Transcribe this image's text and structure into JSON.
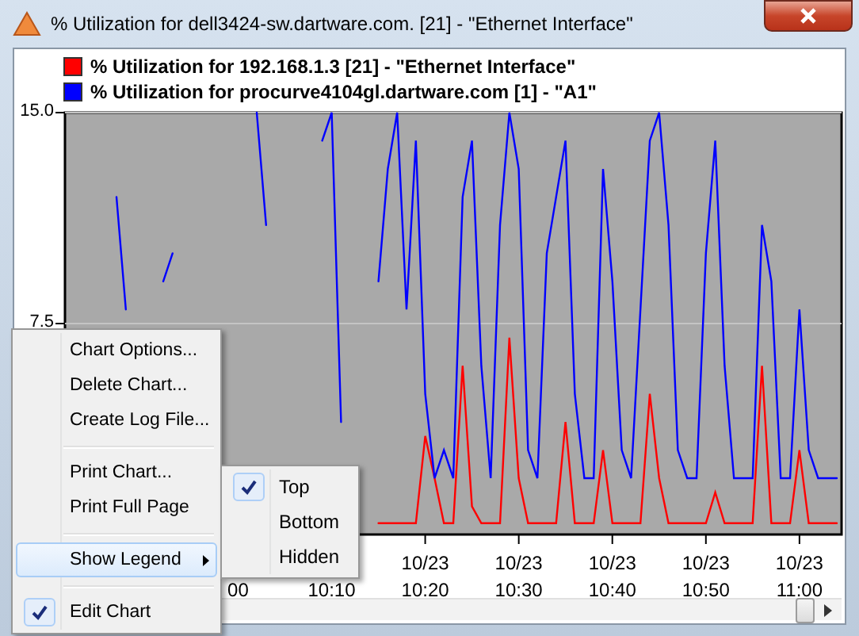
{
  "window": {
    "title": "% Utilization for dell3424-sw.dartware.com. [21] - \"Ethernet Interface\""
  },
  "chart": {
    "chart_data": {
      "type": "line",
      "ylim": [
        0,
        15
      ],
      "yticks": [
        {
          "value": 7.5,
          "label": "7.5"
        },
        {
          "value": 15,
          "label": "15.0"
        }
      ],
      "categories": [
        null,
        null,
        null,
        null,
        null,
        null,
        null,
        null,
        null,
        null,
        null,
        null,
        null,
        null,
        null,
        null,
        null,
        null,
        "00",
        null,
        null,
        null,
        null,
        null,
        null,
        null,
        null,
        null,
        "10:10",
        null,
        null,
        null,
        null,
        null,
        null,
        null,
        null,
        null,
        "10/23 10:20",
        null,
        null,
        null,
        null,
        null,
        null,
        null,
        null,
        null,
        "10/23 10:30",
        null,
        null,
        null,
        null,
        null,
        null,
        null,
        null,
        null,
        "10/23 10:40",
        null,
        null,
        null,
        null,
        null,
        null,
        null,
        null,
        null,
        "10/23 10:50",
        null,
        null,
        null,
        null,
        null,
        null,
        null,
        null,
        null,
        "10/23 11:00",
        null,
        null,
        null,
        null
      ],
      "series": [
        {
          "name": "% Utilization for 192.168.1.3 [21] - \"Ethernet Interface\"",
          "color": "#ff0000",
          "values": [
            null,
            null,
            null,
            null,
            null,
            null,
            null,
            null,
            null,
            null,
            null,
            null,
            null,
            null,
            null,
            null,
            null,
            null,
            null,
            null,
            null,
            null,
            null,
            null,
            null,
            null,
            null,
            null,
            null,
            null,
            null,
            null,
            null,
            0.4,
            0.4,
            0.4,
            0.4,
            0.4,
            3.5,
            2,
            0.4,
            0.4,
            6,
            1,
            0.4,
            0.4,
            0.4,
            7,
            2,
            0.4,
            0.4,
            0.4,
            0.4,
            4,
            0.4,
            0.4,
            0.4,
            3,
            0.4,
            0.4,
            0.4,
            0.4,
            5,
            2,
            0.4,
            0.4,
            0.4,
            0.4,
            0.4,
            1.5,
            0.4,
            0.4,
            0.4,
            0.4,
            6,
            0.4,
            0.4,
            0.4,
            3,
            0.4,
            0.4,
            0.4,
            0.4
          ]
        },
        {
          "name": "% Utilization for procurve4104gl.dartware.com [1] - \"A1\"",
          "color": "#0000ff",
          "values": [
            null,
            null,
            null,
            null,
            null,
            12,
            8,
            null,
            null,
            null,
            9,
            10,
            null,
            null,
            null,
            null,
            null,
            null,
            null,
            null,
            15,
            11,
            null,
            null,
            null,
            null,
            null,
            14,
            15,
            4,
            null,
            null,
            null,
            9,
            13,
            15,
            8,
            14,
            5,
            2,
            3,
            2,
            12,
            14,
            6,
            2,
            11,
            15,
            13,
            3,
            2,
            10,
            12,
            14,
            5,
            2,
            2,
            13,
            9,
            3,
            2,
            8,
            14,
            15,
            11,
            3,
            2,
            2,
            10,
            14,
            6,
            2,
            2,
            2,
            11,
            9,
            2,
            2,
            8,
            3,
            2,
            2,
            2
          ]
        }
      ]
    }
  },
  "context_menu": {
    "items": [
      {
        "kind": "item",
        "label": "Chart Options...",
        "checked": false,
        "selected": false,
        "submenu": false
      },
      {
        "kind": "item",
        "label": "Delete Chart...",
        "checked": false,
        "selected": false,
        "submenu": false
      },
      {
        "kind": "item",
        "label": "Create Log File...",
        "checked": false,
        "selected": false,
        "submenu": false
      },
      {
        "kind": "separator"
      },
      {
        "kind": "item",
        "label": "Print Chart...",
        "checked": false,
        "selected": false,
        "submenu": false
      },
      {
        "kind": "item",
        "label": "Print Full Page",
        "checked": false,
        "selected": false,
        "submenu": false
      },
      {
        "kind": "separator"
      },
      {
        "kind": "item",
        "label": "Show Legend",
        "checked": false,
        "selected": true,
        "submenu": true
      },
      {
        "kind": "separator"
      },
      {
        "kind": "item",
        "label": "Edit Chart",
        "checked": true,
        "selected": false,
        "submenu": false
      }
    ]
  },
  "submenu": {
    "items": [
      {
        "label": "Top",
        "checked": true
      },
      {
        "label": "Bottom",
        "checked": false
      },
      {
        "label": "Hidden",
        "checked": false
      }
    ]
  }
}
